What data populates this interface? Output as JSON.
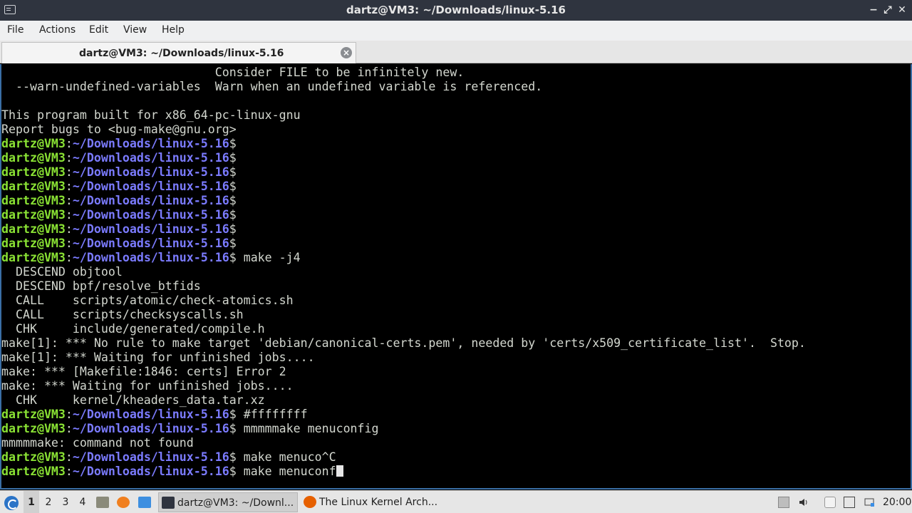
{
  "window": {
    "title": "dartz@VM3: ~/Downloads/linux-5.16",
    "controls": {
      "minimize": "−",
      "maximize": "⤢",
      "close": "✕"
    }
  },
  "menubar": [
    "File",
    "Actions",
    "Edit",
    "View",
    "Help"
  ],
  "tab": {
    "label": "dartz@VM3: ~/Downloads/linux-5.16",
    "close": "×"
  },
  "terminal": {
    "prompt_user": "dartz@VM3",
    "prompt_path": "~/Downloads/linux-5.16",
    "lines": [
      {
        "t": "text",
        "v": "                              Consider FILE to be infinitely new."
      },
      {
        "t": "text",
        "v": "  --warn-undefined-variables  Warn when an undefined variable is referenced."
      },
      {
        "t": "text",
        "v": ""
      },
      {
        "t": "text",
        "v": "This program built for x86_64-pc-linux-gnu"
      },
      {
        "t": "text",
        "v": "Report bugs to <bug-make@gnu.org>"
      },
      {
        "t": "prompt",
        "cmd": ""
      },
      {
        "t": "prompt",
        "cmd": ""
      },
      {
        "t": "prompt",
        "cmd": ""
      },
      {
        "t": "prompt",
        "cmd": ""
      },
      {
        "t": "prompt",
        "cmd": ""
      },
      {
        "t": "prompt",
        "cmd": ""
      },
      {
        "t": "prompt",
        "cmd": ""
      },
      {
        "t": "prompt",
        "cmd": ""
      },
      {
        "t": "prompt",
        "cmd": " make -j4"
      },
      {
        "t": "text",
        "v": "  DESCEND objtool"
      },
      {
        "t": "text",
        "v": "  DESCEND bpf/resolve_btfids"
      },
      {
        "t": "text",
        "v": "  CALL    scripts/atomic/check-atomics.sh"
      },
      {
        "t": "text",
        "v": "  CALL    scripts/checksyscalls.sh"
      },
      {
        "t": "text",
        "v": "  CHK     include/generated/compile.h"
      },
      {
        "t": "text",
        "v": "make[1]: *** No rule to make target 'debian/canonical-certs.pem', needed by 'certs/x509_certificate_list'.  Stop."
      },
      {
        "t": "text",
        "v": "make[1]: *** Waiting for unfinished jobs...."
      },
      {
        "t": "text",
        "v": "make: *** [Makefile:1846: certs] Error 2"
      },
      {
        "t": "text",
        "v": "make: *** Waiting for unfinished jobs...."
      },
      {
        "t": "text",
        "v": "  CHK     kernel/kheaders_data.tar.xz"
      },
      {
        "t": "prompt",
        "cmd": " #ffffffff"
      },
      {
        "t": "prompt",
        "cmd": " mmmmmake menuconfig"
      },
      {
        "t": "text",
        "v": "mmmmmake: command not found"
      },
      {
        "t": "prompt",
        "cmd": " make menuco^C"
      },
      {
        "t": "prompt",
        "cmd": " make menuconf",
        "cursor": true
      }
    ]
  },
  "taskbar": {
    "workspaces": [
      "1",
      "2",
      "3",
      "4"
    ],
    "active_workspace": "1",
    "tasks": [
      {
        "label": "dartz@VM3: ~/Downl...",
        "icon": "terminal-icon",
        "active": true
      },
      {
        "label": "The Linux Kernel Arch...",
        "icon": "firefox-icon",
        "active": false
      }
    ],
    "clock": "20:00"
  },
  "colors": {
    "prompt_user": "#8ae234",
    "prompt_path": "#7b7bff",
    "terminal_text": "#d3d7cf",
    "titlebar": "#2f343f"
  }
}
